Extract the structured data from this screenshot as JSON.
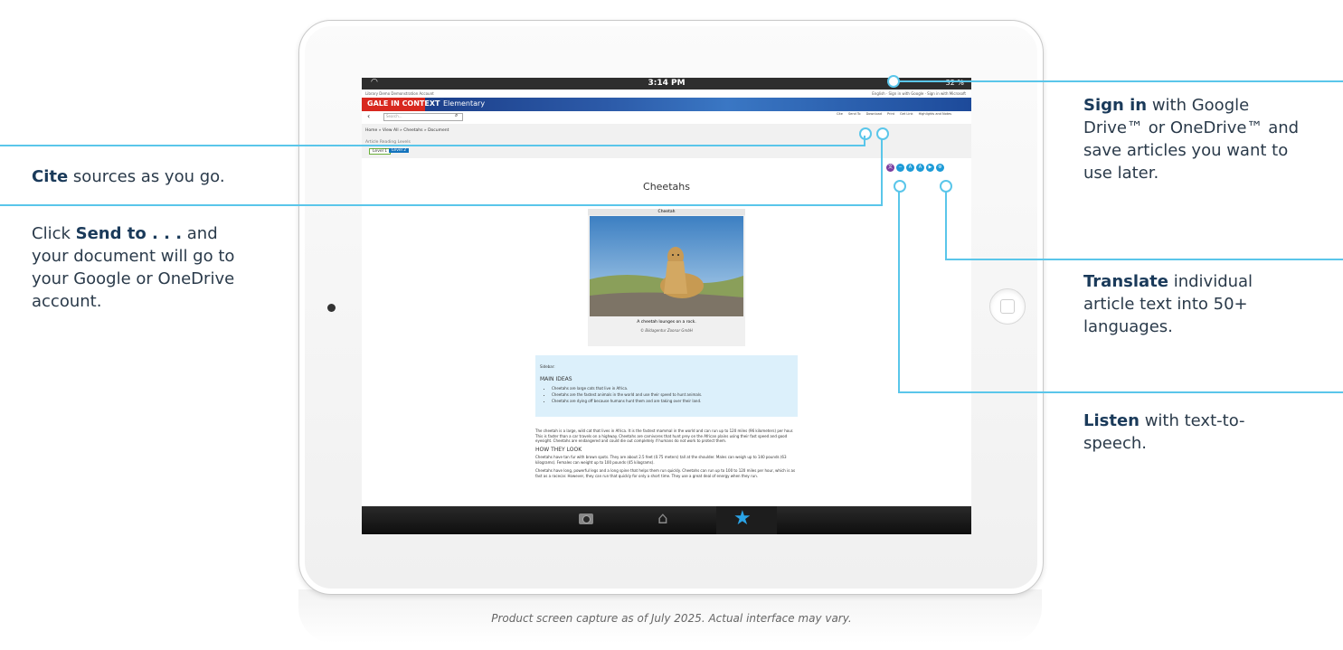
{
  "status": {
    "time": "3:14 PM",
    "battery": "32 %"
  },
  "app": {
    "library": "Library Demo Demonstration Account",
    "account": "English  ·  Sign in with Google  ·  Sign in with Microsoft",
    "brand": "GALE IN CONTEXT",
    "level": "Elementary",
    "search_placeholder": "Search...",
    "tools": [
      "Cite",
      "Send To",
      "Download",
      "Print",
      "Get Link",
      "Highlights and Notes"
    ],
    "breadcrumb": "Home » View All » Cheetahs » Document",
    "reading_levels_label": "Article Reading Levels",
    "level1": "Level 1",
    "level2": "Level 2"
  },
  "article": {
    "title": "Cheetahs",
    "figure_title": "Cheetah",
    "figure_caption": "A cheetah lounges on a rock.",
    "figure_credit": "© Bildagentur Zoonar GmbH",
    "sidebar_label": "Sidebar:",
    "main_ideas": "MAIN IDEAS",
    "ideas": [
      "Cheetahs are large cats that live in Africa.",
      "Cheetahs are the fastest animals in the world and use their speed to hunt animals.",
      "Cheetahs are dying off because humans hunt them and are taking over their land."
    ],
    "para1": "The cheetah is a large, wild cat that lives in Africa. It is the fastest mammal in the world and can run up to 120 miles (96 kilometers) per hour. This is faster than a car travels on a highway. Cheetahs are carnivores that hunt prey on the African plains using their fast speed and good eyesight. Cheetahs are endangered and could die out completely if humans do not work to protect them.",
    "heading2": "HOW THEY LOOK",
    "para2": "Cheetahs have tan fur with brown spots. They are about 2.5 feet (0.75 meters) tall at the shoulder. Males can weigh up to 140 pounds (63 kilograms). Females can weight up to 100 pounds (45 kilograms).",
    "para3": "Cheetahs have long, powerful legs and a long spine that helps them run quickly. Cheetahs can run up to 100 to 120 miles per hour, which is as fast as a racecar. However, they can run that quickly for only a short time. They use a great deal of energy when they run."
  },
  "callouts": {
    "cite_bold": "Cite",
    "cite_text": " sources as you go.",
    "send_pre": "Click ",
    "send_bold": "Send to . . .",
    "send_text": " and your document will go to your Google or OneDrive account.",
    "signin_bold": "Sign in",
    "signin_text": " with Google Drive™ or OneDrive™ and save articles you want to use later.",
    "translate_bold": "Translate",
    "translate_text": " individual article text into 50+ languages.",
    "listen_bold": "Listen",
    "listen_text": " with text-to-speech."
  },
  "caption": "Product screen capture as of July 2025. Actual interface may vary."
}
